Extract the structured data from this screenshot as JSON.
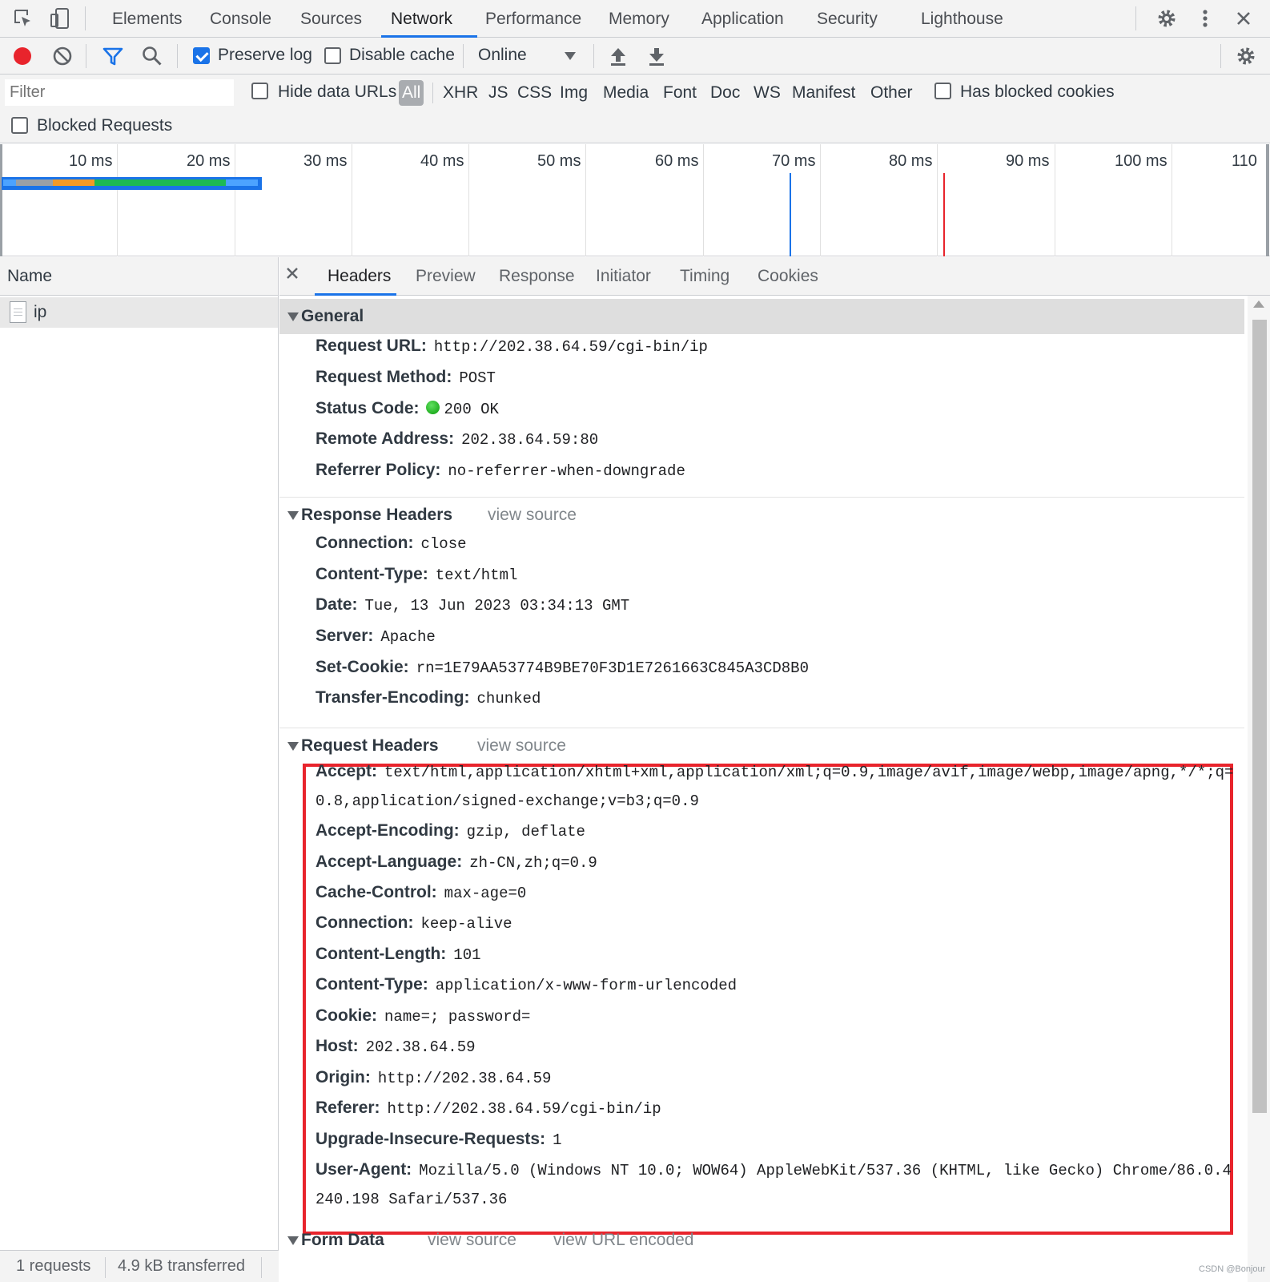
{
  "tabs": [
    "Elements",
    "Console",
    "Sources",
    "Network",
    "Performance",
    "Memory",
    "Application",
    "Security",
    "Lighthouse"
  ],
  "active_tab": "Network",
  "toolbar": {
    "preserve_log": "Preserve log",
    "preserve_log_checked": true,
    "disable_cache": "Disable cache",
    "disable_cache_checked": false,
    "throttling": "Online"
  },
  "filter": {
    "placeholder": "Filter",
    "hide_data_urls": "Hide data URLs",
    "types": [
      "All",
      "XHR",
      "JS",
      "CSS",
      "Img",
      "Media",
      "Font",
      "Doc",
      "WS",
      "Manifest",
      "Other"
    ],
    "selected_type": "All",
    "has_blocked_cookies": "Has blocked cookies",
    "blocked_requests": "Blocked Requests"
  },
  "overview": {
    "ticks": [
      "10 ms",
      "20 ms",
      "30 ms",
      "40 ms",
      "50 ms",
      "60 ms",
      "70 ms",
      "80 ms",
      "90 ms",
      "100 ms",
      "110"
    ],
    "markers": {
      "dom_content_loaded_color": "#1a73e8",
      "load_color": "#e8242c"
    }
  },
  "name_pane": {
    "header": "Name",
    "rows": [
      {
        "name": "ip"
      }
    ]
  },
  "status": {
    "requests": "1 requests",
    "transferred": "4.9 kB transferred"
  },
  "detail_tabs": [
    "Headers",
    "Preview",
    "Response",
    "Initiator",
    "Timing",
    "Cookies"
  ],
  "active_detail_tab": "Headers",
  "general": {
    "title": "General",
    "rows": [
      {
        "key": "Request URL:",
        "value": "http://202.38.64.59/cgi-bin/ip"
      },
      {
        "key": "Request Method:",
        "value": "POST"
      },
      {
        "key": "Status Code:",
        "value": "200 OK"
      },
      {
        "key": "Remote Address:",
        "value": "202.38.64.59:80"
      },
      {
        "key": "Referrer Policy:",
        "value": "no-referrer-when-downgrade"
      }
    ]
  },
  "response_headers": {
    "title": "Response Headers",
    "view_source": "view source",
    "rows": [
      {
        "key": "Connection:",
        "value": "close"
      },
      {
        "key": "Content-Type:",
        "value": "text/html"
      },
      {
        "key": "Date:",
        "value": "Tue, 13 Jun 2023 03:34:13 GMT"
      },
      {
        "key": "Server:",
        "value": "Apache"
      },
      {
        "key": "Set-Cookie:",
        "value": "rn=1E79AA53774B9BE70F3D1E7261663C845A3CD8B0"
      },
      {
        "key": "Transfer-Encoding:",
        "value": "chunked"
      }
    ]
  },
  "request_headers": {
    "title": "Request Headers",
    "view_source": "view source",
    "rows": [
      {
        "key": "Accept:",
        "value": "text/html,application/xhtml+xml,application/xml;q=0.9,image/avif,image/webp,image/apng,*/*;q=",
        "cont": "0.8,application/signed-exchange;v=b3;q=0.9"
      },
      {
        "key": "Accept-Encoding:",
        "value": "gzip, deflate"
      },
      {
        "key": "Accept-Language:",
        "value": "zh-CN,zh;q=0.9"
      },
      {
        "key": "Cache-Control:",
        "value": "max-age=0"
      },
      {
        "key": "Connection:",
        "value": "keep-alive"
      },
      {
        "key": "Content-Length:",
        "value": "101"
      },
      {
        "key": "Content-Type:",
        "value": "application/x-www-form-urlencoded"
      },
      {
        "key": "Cookie:",
        "value": "name=; password="
      },
      {
        "key": "Host:",
        "value": "202.38.64.59"
      },
      {
        "key": "Origin:",
        "value": "http://202.38.64.59"
      },
      {
        "key": "Referer:",
        "value": "http://202.38.64.59/cgi-bin/ip"
      },
      {
        "key": "Upgrade-Insecure-Requests:",
        "value": "1"
      },
      {
        "key": "User-Agent:",
        "value": "Mozilla/5.0 (Windows NT 10.0; WOW64) AppleWebKit/537.36 (KHTML, like Gecko) Chrome/86.0.4",
        "cont": "240.198 Safari/537.36"
      }
    ]
  },
  "form_data": {
    "title": "Form Data",
    "view_source": "view source",
    "view_url_encoded": "view URL encoded"
  },
  "watermark": "CSDN @Bonjour"
}
